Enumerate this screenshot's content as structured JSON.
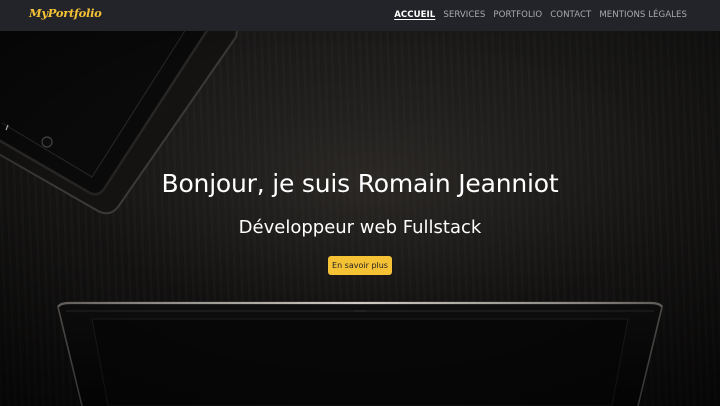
{
  "navbar": {
    "brand": "MyPortfolio",
    "links": [
      {
        "label": "ACCUEIL",
        "active": true
      },
      {
        "label": "SERVICES",
        "active": false
      },
      {
        "label": "PORTFOLIO",
        "active": false
      },
      {
        "label": "CONTACT",
        "active": false
      },
      {
        "label": "MENTIONS LÉGALES",
        "active": false
      }
    ]
  },
  "hero": {
    "title": "Bonjour, je suis Romain Jeanniot",
    "subtitle": "Développeur web Fullstack",
    "cta_label": "En savoir plus"
  },
  "colors": {
    "accent": "#f5c236",
    "navbar_bg": "#222429",
    "nav_link": "#a9aaad",
    "nav_link_active": "#ffffff"
  }
}
